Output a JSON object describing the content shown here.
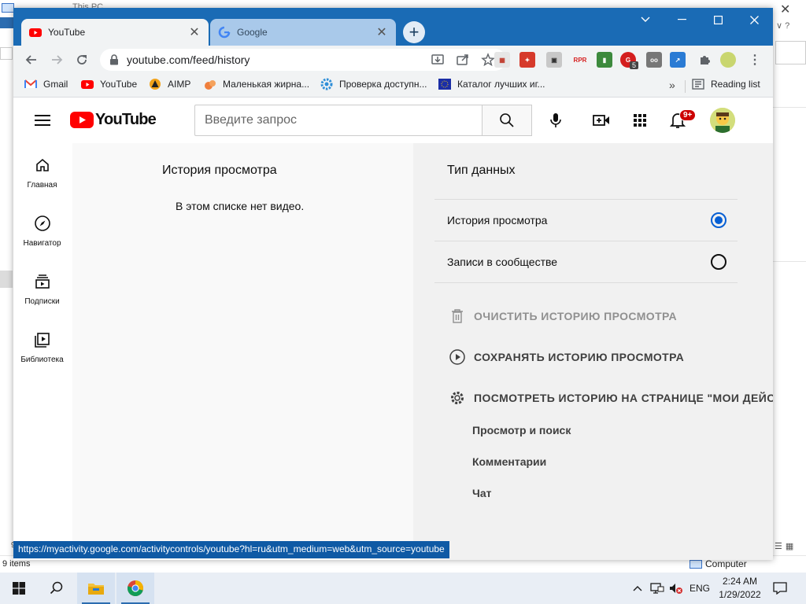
{
  "background_window": {
    "title": "This PC",
    "status_items": "9 items",
    "status_location": "Computer",
    "partial_count": "9"
  },
  "browser": {
    "tabs": [
      {
        "label": "YouTube",
        "icon": "youtube-favicon",
        "active": true
      },
      {
        "label": "Google",
        "icon": "google-favicon",
        "active": false
      }
    ],
    "url": "youtube.com/feed/history",
    "bookmarks": [
      {
        "label": "Gmail",
        "icon": "gmail-icon"
      },
      {
        "label": "YouTube",
        "icon": "youtube-icon"
      },
      {
        "label": "AIMP",
        "icon": "aimp-icon"
      },
      {
        "label": "Маленькая жирна...",
        "icon": "bookmark-orange-icon"
      },
      {
        "label": "Проверка доступн...",
        "icon": "gear-blue-icon"
      },
      {
        "label": "Каталог лучших иг...",
        "icon": "eu-flag-icon"
      }
    ],
    "reading_list": "Reading list",
    "extension_badge": "5",
    "status_bar_url": "https://myactivity.google.com/activitycontrols/youtube?hl=ru&utm_medium=web&utm_source=youtube",
    "colors": {
      "tabstrip": "#1a6bb5",
      "toolbar": "#f1f3f4"
    }
  },
  "youtube": {
    "logo_text": "YouTube",
    "search_placeholder": "Введите запрос",
    "notification_count": "9+",
    "guide": [
      {
        "label": "Главная",
        "icon": "home-icon"
      },
      {
        "label": "Навигатор",
        "icon": "compass-icon"
      },
      {
        "label": "Подписки",
        "icon": "subscriptions-icon"
      },
      {
        "label": "Библиотека",
        "icon": "library-icon"
      }
    ],
    "history_title": "История просмотра",
    "empty_message": "В этом списке нет видео.",
    "data_type_title": "Тип данных",
    "data_types": [
      {
        "label": "История просмотра",
        "selected": true
      },
      {
        "label": "Записи в сообществе",
        "selected": false
      }
    ],
    "actions": [
      {
        "label": "ОЧИСТИТЬ ИСТОРИЮ ПРОСМОТРА",
        "icon": "trash-icon",
        "enabled": false
      },
      {
        "label": "СОХРАНЯТЬ ИСТОРИЮ ПРОСМОТРА",
        "icon": "play-circle-icon",
        "enabled": true
      },
      {
        "label": "ПОСМОТРЕТЬ ИСТОРИЮ НА СТРАНИЦЕ \"МОИ ДЕЙС",
        "icon": "gear-icon",
        "enabled": true
      }
    ],
    "sub_links": [
      "Просмотр и поиск",
      "Комментарии",
      "Чат"
    ],
    "colors": {
      "brand_red": "#ff0000",
      "radio_selected": "#065fd4"
    }
  },
  "taskbar": {
    "language": "ENG",
    "time": "2:24 AM",
    "date": "1/29/2022"
  }
}
